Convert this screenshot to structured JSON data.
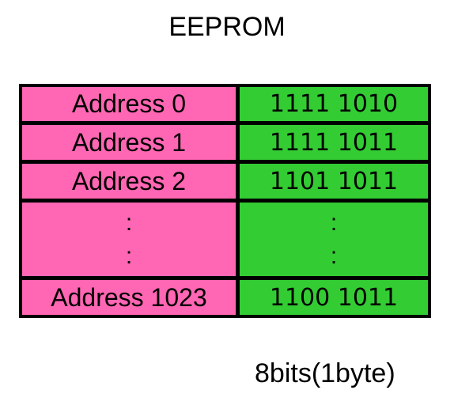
{
  "title": "EEPROM",
  "rows": [
    {
      "address": "Address 0",
      "value": "1111 1010"
    },
    {
      "address": "Address 1",
      "value": "1111 1011"
    },
    {
      "address": "Address 2",
      "value": "1101 1011"
    },
    {
      "address": ":",
      "value": ":",
      "ellipsis": true
    },
    {
      "address": "Address 1023",
      "value": "1100 1011"
    }
  ],
  "footer": "8bits(1byte)",
  "colors": {
    "address_bg": "#ff66b3",
    "value_bg": "#33cc33",
    "border": "#000000"
  }
}
